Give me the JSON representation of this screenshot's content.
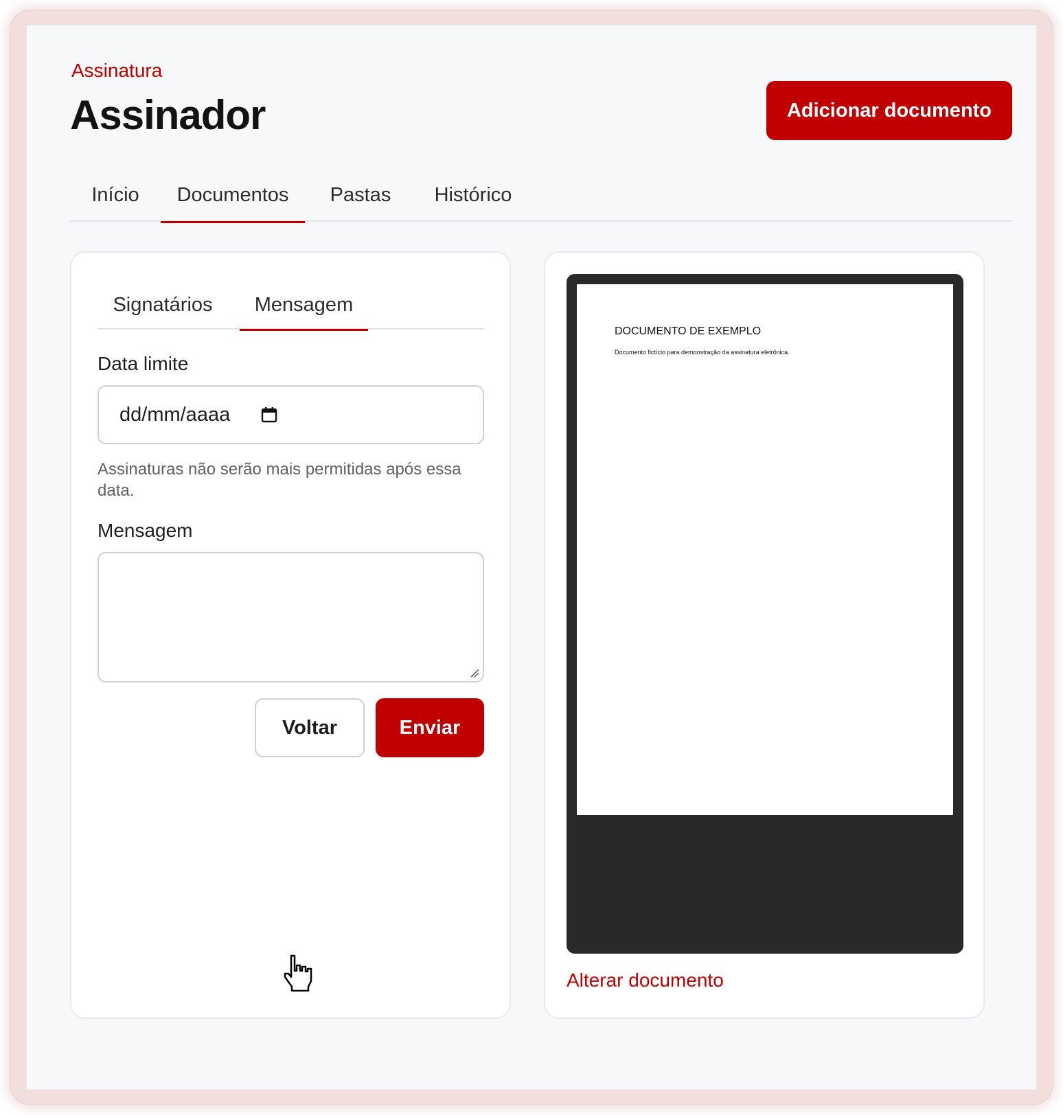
{
  "header": {
    "eyebrow": "Assinatura",
    "title": "Assinador",
    "add_button": "Adicionar documento"
  },
  "tabs": [
    {
      "label": "Início",
      "active": false
    },
    {
      "label": "Documentos",
      "active": true
    },
    {
      "label": "Pastas",
      "active": false
    },
    {
      "label": "Histórico",
      "active": false
    }
  ],
  "form": {
    "subtabs": [
      {
        "label": "Signatários",
        "active": false
      },
      {
        "label": "Mensagem",
        "active": true
      }
    ],
    "date_label": "Data limite",
    "date_placeholder": "dd/mm/aaaa",
    "date_hint": "Assinaturas não serão mais permitidas após essa data.",
    "message_label": "Mensagem",
    "message_value": "",
    "back_button": "Voltar",
    "send_button": "Enviar"
  },
  "preview": {
    "doc_title": "DOCUMENTO DE EXEMPLO",
    "doc_subtitle": "Documento fictício para demonstração da assinatura eletrônica.",
    "change_link": "Alterar documento"
  },
  "icons": {
    "calendar": "calendar-icon",
    "resize": "resize-handle-icon",
    "cursor": "hand-pointer-icon"
  },
  "colors": {
    "accent": "#c00000",
    "background": "#f7f8fa",
    "viewer": "#292929"
  }
}
